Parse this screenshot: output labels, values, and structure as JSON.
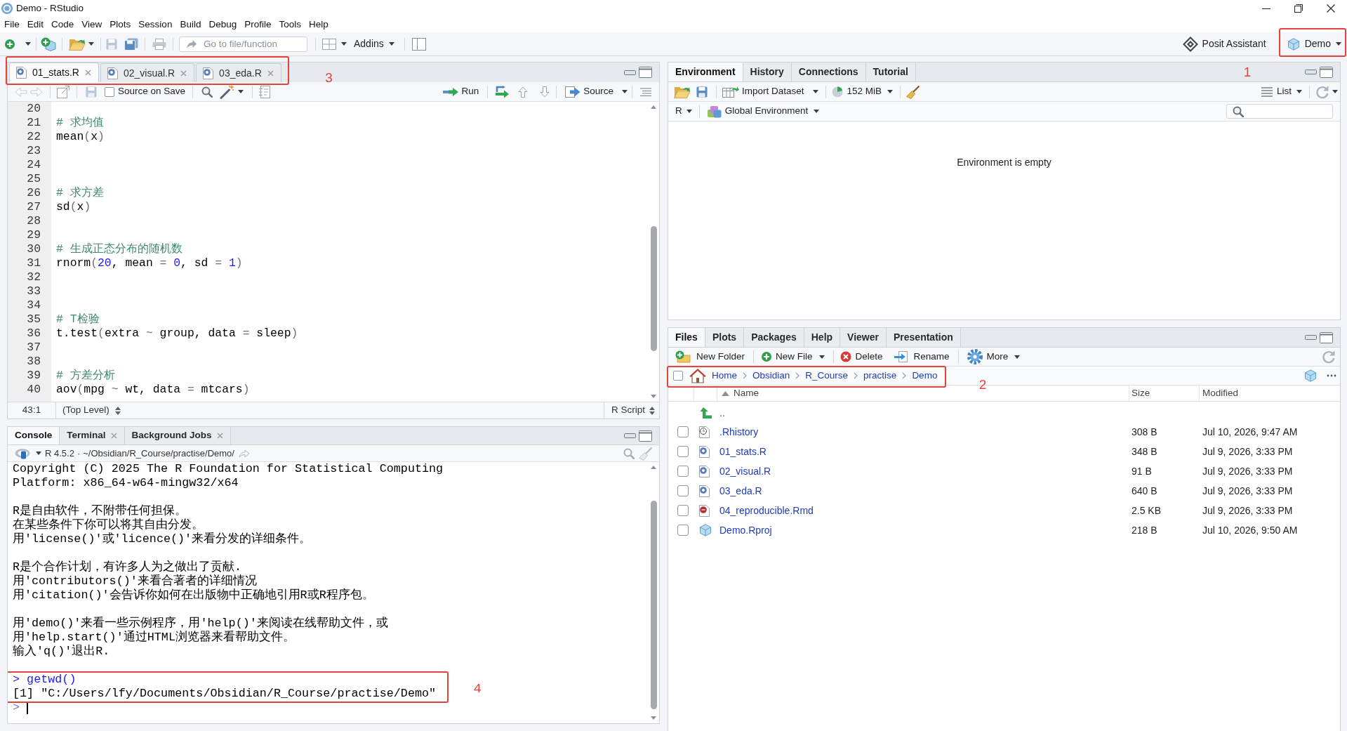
{
  "window": {
    "title": "Demo - RStudio"
  },
  "menu": [
    "File",
    "Edit",
    "Code",
    "View",
    "Plots",
    "Session",
    "Build",
    "Debug",
    "Profile",
    "Tools",
    "Help"
  ],
  "toolbar": {
    "goto": {
      "placeholder": "Go to file/function"
    },
    "addins": "Addins",
    "assistant": "Posit Assistant",
    "project": {
      "label": "Demo",
      "annotation": "1"
    }
  },
  "editor": {
    "tabs": [
      {
        "label": "01_stats.R",
        "selected": true
      },
      {
        "label": "02_visual.R",
        "selected": false
      },
      {
        "label": "03_eda.R",
        "selected": false
      }
    ],
    "tabs_annotation": "3",
    "source_on_save": {
      "label": "Source on Save",
      "checked": false
    },
    "run": "Run",
    "source": "Source",
    "lines": [
      {
        "number": "20"
      },
      {
        "number": "21",
        "tokens": [
          {
            "kind": "comment",
            "text": "# 求均值"
          }
        ]
      },
      {
        "number": "22",
        "tokens": [
          {
            "kind": "plain",
            "text": "mean"
          },
          {
            "kind": "operator",
            "text": "("
          },
          {
            "kind": "plain",
            "text": "x"
          },
          {
            "kind": "operator",
            "text": ")"
          }
        ]
      },
      {
        "number": "23"
      },
      {
        "number": "24"
      },
      {
        "number": "25"
      },
      {
        "number": "26",
        "tokens": [
          {
            "kind": "comment",
            "text": "# 求方差"
          }
        ]
      },
      {
        "number": "27",
        "tokens": [
          {
            "kind": "plain",
            "text": "sd"
          },
          {
            "kind": "operator",
            "text": "("
          },
          {
            "kind": "plain",
            "text": "x"
          },
          {
            "kind": "operator",
            "text": ")"
          }
        ]
      },
      {
        "number": "28"
      },
      {
        "number": "29"
      },
      {
        "number": "30",
        "tokens": [
          {
            "kind": "comment",
            "text": "# 生成正态分布的随机数"
          }
        ]
      },
      {
        "number": "31",
        "tokens": [
          {
            "kind": "plain",
            "text": "rnorm"
          },
          {
            "kind": "operator",
            "text": "("
          },
          {
            "kind": "number",
            "text": "20"
          },
          {
            "kind": "plain",
            "text": ", mean "
          },
          {
            "kind": "operator",
            "text": "= "
          },
          {
            "kind": "number",
            "text": "0"
          },
          {
            "kind": "plain",
            "text": ", sd "
          },
          {
            "kind": "operator",
            "text": "= "
          },
          {
            "kind": "number",
            "text": "1"
          },
          {
            "kind": "operator",
            "text": ")"
          }
        ]
      },
      {
        "number": "32"
      },
      {
        "number": "33"
      },
      {
        "number": "34"
      },
      {
        "number": "35",
        "tokens": [
          {
            "kind": "comment",
            "text": "# T检验"
          }
        ]
      },
      {
        "number": "36",
        "tokens": [
          {
            "kind": "plain",
            "text": "t.test"
          },
          {
            "kind": "operator",
            "text": "("
          },
          {
            "kind": "plain",
            "text": "extra "
          },
          {
            "kind": "operator",
            "text": "~"
          },
          {
            "kind": "plain",
            "text": " group, data "
          },
          {
            "kind": "operator",
            "text": "="
          },
          {
            "kind": "plain",
            "text": " sleep"
          },
          {
            "kind": "operator",
            "text": ")"
          }
        ]
      },
      {
        "number": "37"
      },
      {
        "number": "38"
      },
      {
        "number": "39",
        "tokens": [
          {
            "kind": "comment",
            "text": "# 方差分析"
          }
        ]
      },
      {
        "number": "40",
        "tokens": [
          {
            "kind": "plain",
            "text": "aov"
          },
          {
            "kind": "operator",
            "text": "("
          },
          {
            "kind": "plain",
            "text": "mpg "
          },
          {
            "kind": "operator",
            "text": "~"
          },
          {
            "kind": "plain",
            "text": " wt, data "
          },
          {
            "kind": "operator",
            "text": "="
          },
          {
            "kind": "plain",
            "text": " mtcars"
          },
          {
            "kind": "operator",
            "text": ")"
          }
        ]
      }
    ],
    "status": {
      "position": "43:1",
      "scope": "(Top Level)",
      "file_type": "R Script"
    }
  },
  "console": {
    "tabs": [
      {
        "label": "Console",
        "selected": true,
        "closable": false
      },
      {
        "label": "Terminal",
        "selected": false,
        "closable": true
      },
      {
        "label": "Background Jobs",
        "selected": false,
        "closable": true
      }
    ],
    "r_version": "R 4.5.2",
    "separator": "·",
    "working_directory": "~/Obsidian/R_Course/practise/Demo/",
    "output": [
      {
        "kind": "output",
        "text": "Copyright (C) 2025 The R Foundation for Statistical Computing"
      },
      {
        "kind": "output",
        "text": "Platform: x86_64-w64-mingw32/x64"
      },
      {
        "kind": "blank"
      },
      {
        "kind": "output",
        "text": "R是自由软件，不附带任何担保。"
      },
      {
        "kind": "output",
        "text": "在某些条件下你可以将其自由分发。"
      },
      {
        "kind": "output",
        "text": "用'license()'或'licence()'来看分发的详细条件。"
      },
      {
        "kind": "blank"
      },
      {
        "kind": "output",
        "text": "R是个合作计划，有许多人为之做出了贡献."
      },
      {
        "kind": "output",
        "text": "用'contributors()'来看合著者的详细情况"
      },
      {
        "kind": "output",
        "text": "用'citation()'会告诉你如何在出版物中正确地引用R或R程序包。"
      },
      {
        "kind": "blank"
      },
      {
        "kind": "output",
        "text": "用'demo()'来看一些示例程序，用'help()'来阅读在线帮助文件，或"
      },
      {
        "kind": "output",
        "text": "用'help.start()'通过HTML浏览器来看帮助文件。"
      },
      {
        "kind": "output",
        "text": "输入'q()'退出R."
      },
      {
        "kind": "blank"
      }
    ],
    "highlight": {
      "annotation": "4",
      "lines": [
        {
          "kind": "input",
          "text": "> getwd()"
        },
        {
          "kind": "output",
          "text": "[1] \"C:/Users/lfy/Documents/Obsidian/R_Course/practise/Demo\""
        }
      ]
    },
    "prompt": ">"
  },
  "environment": {
    "tabs": [
      {
        "label": "Environment",
        "selected": true
      },
      {
        "label": "History",
        "selected": false
      },
      {
        "label": "Connections",
        "selected": false
      },
      {
        "label": "Tutorial",
        "selected": false
      }
    ],
    "import_dataset": "Import Dataset",
    "memory": "152 MiB",
    "view_mode": "List",
    "language": "R",
    "scope": "Global Environment",
    "message": "Environment is empty"
  },
  "files": {
    "tabs": [
      {
        "label": "Files",
        "selected": true
      },
      {
        "label": "Plots",
        "selected": false
      },
      {
        "label": "Packages",
        "selected": false
      },
      {
        "label": "Help",
        "selected": false
      },
      {
        "label": "Viewer",
        "selected": false
      },
      {
        "label": "Presentation",
        "selected": false
      }
    ],
    "actions": [
      {
        "kind": "new_folder",
        "label": "New Folder",
        "has_menu": false
      },
      {
        "kind": "new_file",
        "label": "New File",
        "has_menu": true
      },
      {
        "kind": "delete",
        "label": "Delete",
        "has_menu": false
      },
      {
        "kind": "rename",
        "label": "Rename",
        "has_menu": false
      },
      {
        "kind": "more",
        "label": "More",
        "has_menu": true
      }
    ],
    "select_all": {
      "checked": false
    },
    "breadcrumb": [
      "Home",
      "Obsidian",
      "R_Course",
      "practise",
      "Demo"
    ],
    "breadcrumb_annotation": "2",
    "columns": {
      "name": "Name",
      "size": "Size",
      "modified": "Modified"
    },
    "parent_link": "..",
    "rows": [
      {
        "name": ".Rhistory",
        "kind": "history",
        "size": "308 B",
        "modified": "Jul 10, 2026, 9:47 AM",
        "checked": false
      },
      {
        "name": "01_stats.R",
        "kind": "r",
        "size": "348 B",
        "modified": "Jul 9, 2026, 3:33 PM",
        "checked": false
      },
      {
        "name": "02_visual.R",
        "kind": "r",
        "size": "91 B",
        "modified": "Jul 9, 2026, 3:33 PM",
        "checked": false
      },
      {
        "name": "03_eda.R",
        "kind": "r",
        "size": "640 B",
        "modified": "Jul 9, 2026, 3:33 PM",
        "checked": false
      },
      {
        "name": "04_reproducible.Rmd",
        "kind": "rmd",
        "size": "2.5 KB",
        "modified": "Jul 9, 2026, 3:33 PM",
        "checked": false
      },
      {
        "name": "Demo.Rproj",
        "kind": "rproj",
        "size": "218 B",
        "modified": "Jul 10, 2026, 9:50 AM",
        "checked": false
      }
    ]
  }
}
